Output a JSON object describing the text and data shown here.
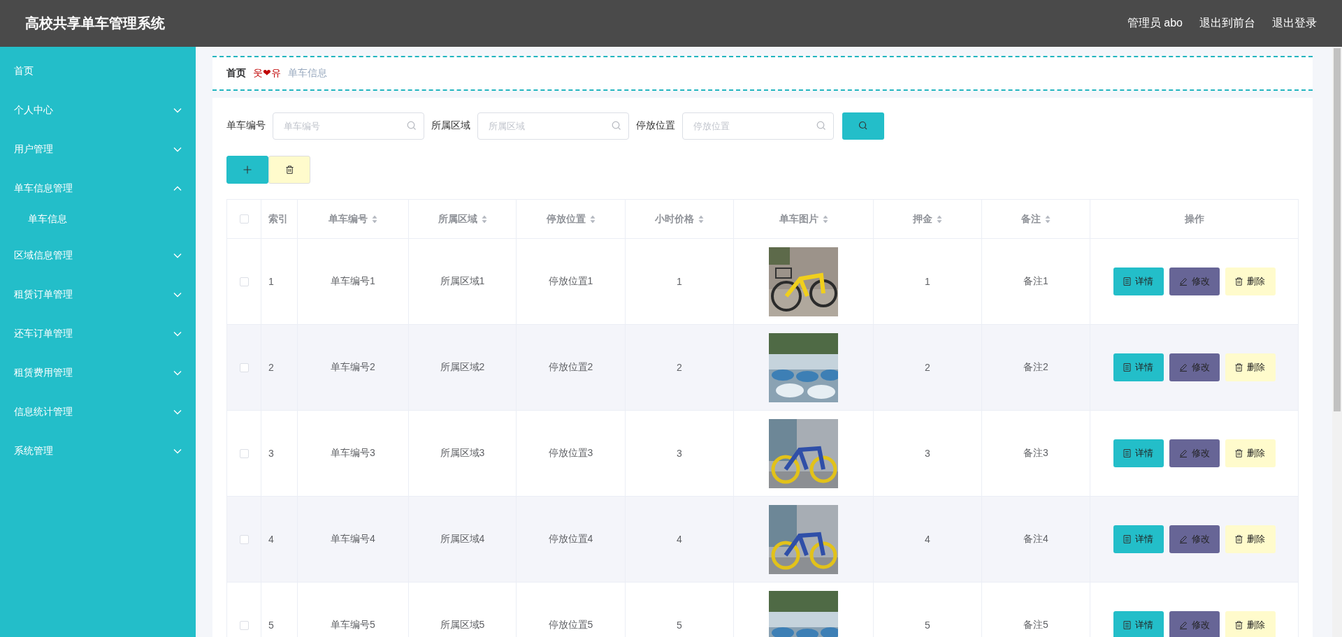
{
  "app": {
    "title": "高校共享单车管理系统",
    "user": "管理员 abo",
    "links": [
      "退出到前台",
      "退出登录"
    ]
  },
  "sidebar": {
    "items": [
      {
        "label": "首页",
        "kind": "link"
      },
      {
        "label": "个人中心",
        "kind": "menu",
        "expanded": false
      },
      {
        "label": "用户管理",
        "kind": "menu",
        "expanded": false
      },
      {
        "label": "单车信息管理",
        "kind": "menu",
        "expanded": true,
        "children": [
          {
            "label": "单车信息"
          }
        ]
      },
      {
        "label": "区域信息管理",
        "kind": "menu",
        "expanded": false
      },
      {
        "label": "租赁订单管理",
        "kind": "menu",
        "expanded": false
      },
      {
        "label": "还车订单管理",
        "kind": "menu",
        "expanded": false
      },
      {
        "label": "租赁费用管理",
        "kind": "menu",
        "expanded": false
      },
      {
        "label": "信息统计管理",
        "kind": "menu",
        "expanded": false
      },
      {
        "label": "系统管理",
        "kind": "menu",
        "expanded": false
      }
    ]
  },
  "breadcrumb": {
    "items": [
      "首页",
      "单车信息"
    ],
    "separator": "웃❤유"
  },
  "search": {
    "filters": [
      {
        "label": "单车编号",
        "placeholder": "单车编号"
      },
      {
        "label": "所属区域",
        "placeholder": "所属区域"
      },
      {
        "label": "停放位置",
        "placeholder": "停放位置"
      }
    ]
  },
  "table": {
    "all_checked": false,
    "columns": [
      {
        "label": "索引",
        "sortable": false
      },
      {
        "label": "单车编号",
        "sortable": true
      },
      {
        "label": "所属区域",
        "sortable": true
      },
      {
        "label": "停放位置",
        "sortable": true
      },
      {
        "label": "小时价格",
        "sortable": true
      },
      {
        "label": "单车图片",
        "sortable": true
      },
      {
        "label": "押金",
        "sortable": true
      },
      {
        "label": "备注",
        "sortable": true
      },
      {
        "label": "操作",
        "sortable": false
      }
    ],
    "rows": [
      {
        "checked": false,
        "index": "1",
        "code": "单车编号1",
        "area": "所属区域1",
        "location": "停放位置1",
        "price": "1",
        "deposit": "1",
        "note": "备注1",
        "actions": [
          {
            "kind": "detail",
            "label": "详情"
          },
          {
            "kind": "edit",
            "label": "修改"
          },
          {
            "kind": "delete",
            "label": "删除"
          }
        ]
      },
      {
        "checked": false,
        "index": "2",
        "code": "单车编号2",
        "area": "所属区域2",
        "location": "停放位置2",
        "price": "2",
        "deposit": "2",
        "note": "备注2",
        "actions": [
          {
            "kind": "detail",
            "label": "详情"
          },
          {
            "kind": "edit",
            "label": "修改"
          },
          {
            "kind": "delete",
            "label": "删除"
          }
        ]
      },
      {
        "checked": false,
        "index": "3",
        "code": "单车编号3",
        "area": "所属区域3",
        "location": "停放位置3",
        "price": "3",
        "deposit": "3",
        "note": "备注3",
        "actions": [
          {
            "kind": "detail",
            "label": "详情"
          },
          {
            "kind": "edit",
            "label": "修改"
          },
          {
            "kind": "delete",
            "label": "删除"
          }
        ]
      },
      {
        "checked": false,
        "index": "4",
        "code": "单车编号4",
        "area": "所属区域4",
        "location": "停放位置4",
        "price": "4",
        "deposit": "4",
        "note": "备注4",
        "actions": [
          {
            "kind": "detail",
            "label": "详情"
          },
          {
            "kind": "edit",
            "label": "修改"
          },
          {
            "kind": "delete",
            "label": "删除"
          }
        ]
      },
      {
        "checked": false,
        "index": "5",
        "code": "单车编号5",
        "area": "所属区域5",
        "location": "停放位置5",
        "price": "5",
        "deposit": "5",
        "note": "备注5",
        "actions": [
          {
            "kind": "detail",
            "label": "详情"
          },
          {
            "kind": "edit",
            "label": "修改"
          },
          {
            "kind": "delete",
            "label": "删除"
          }
        ]
      }
    ]
  }
}
